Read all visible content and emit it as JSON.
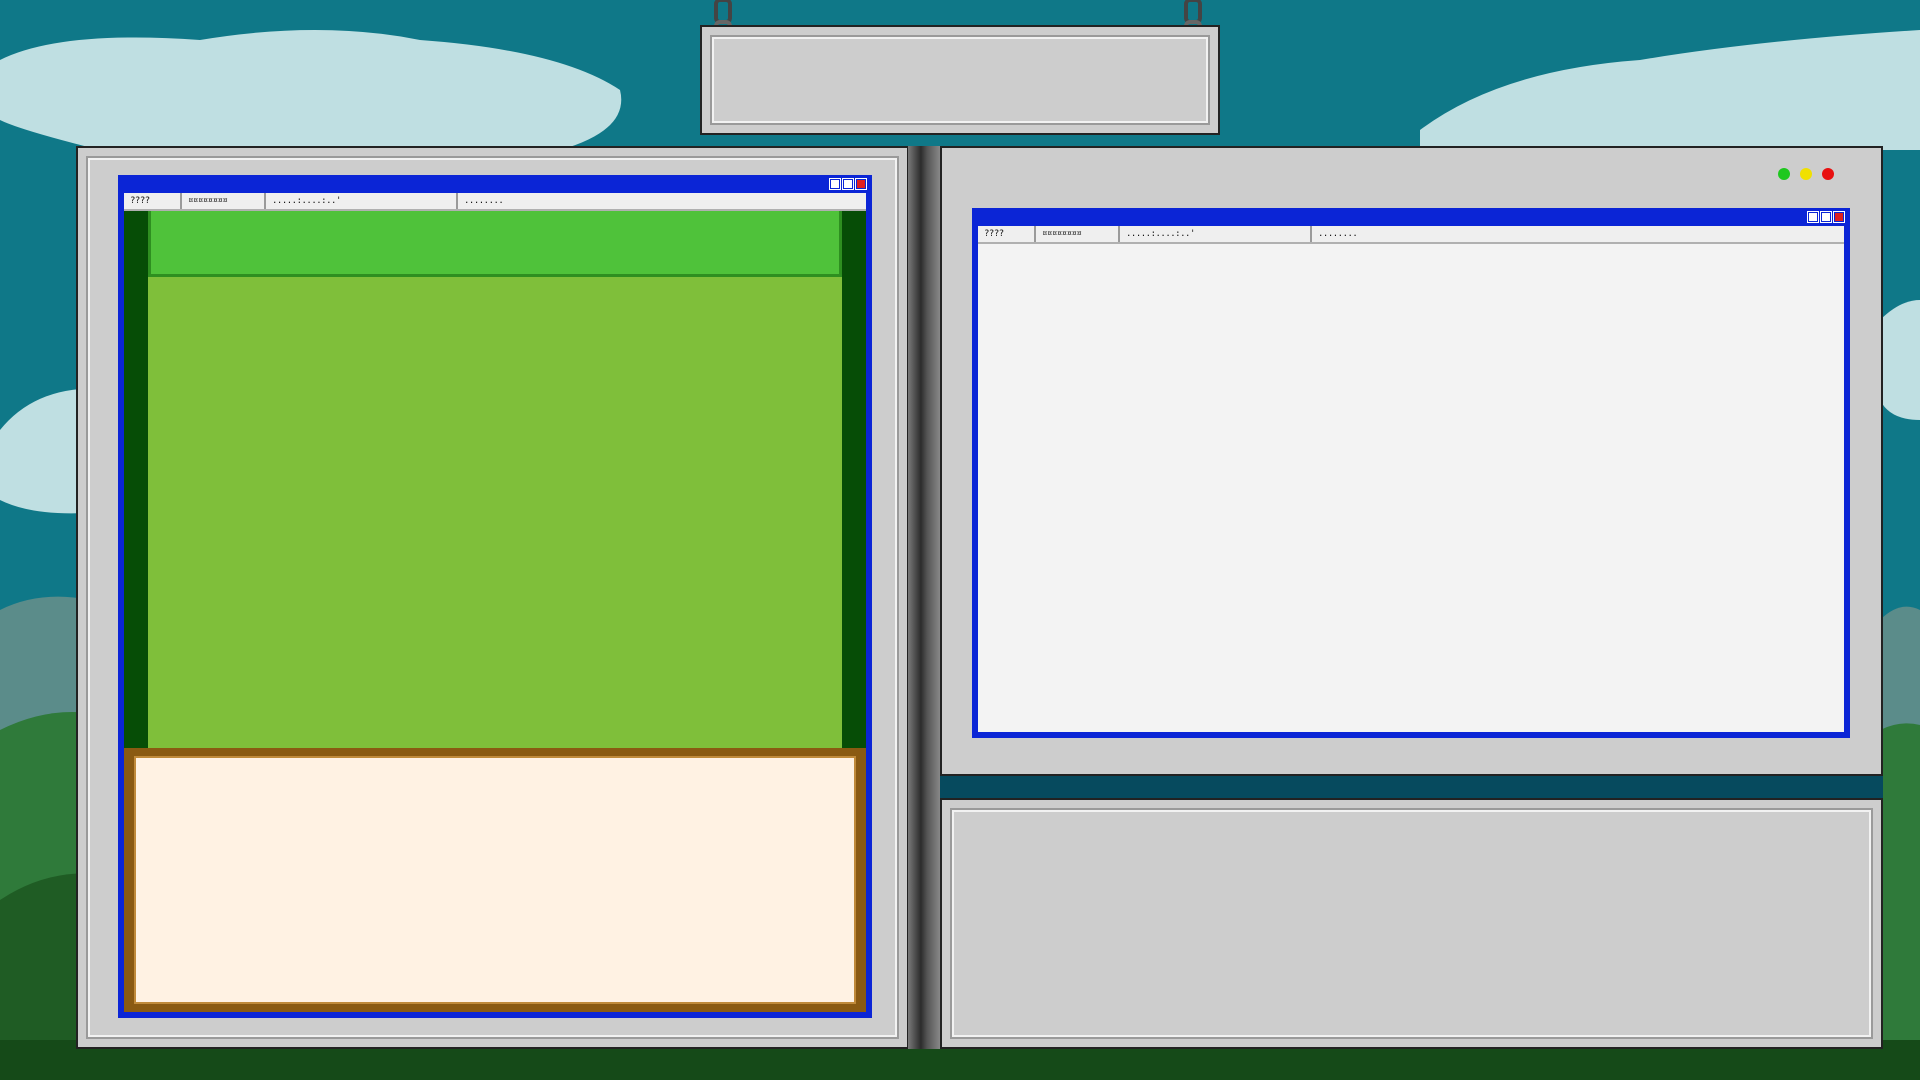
{
  "scene": {
    "sky_color": "#0f7888",
    "cloud_color": "#bfdfe2",
    "hill_colors": [
      "#5b8c8a",
      "#2f7a3a",
      "#1f5c24",
      "#154a18"
    ]
  },
  "sign_board": {
    "text": "",
    "chain_icon": "chain-icon"
  },
  "left_window": {
    "tabs": [
      "????",
      "¤¤¤¤¤¤¤¤",
      ".....:....:..'",
      "........"
    ],
    "title_buttons": [
      "minimize-icon",
      "maximize-icon",
      "close-icon"
    ],
    "header_color": "#4fc23a",
    "content_color": "#7fbf3a",
    "side_color": "#064d06",
    "dialog_box": {
      "text": "",
      "fill": "#fff2e3",
      "border": "#8a5a12"
    }
  },
  "right_window": {
    "tabs": [
      "????",
      "¤¤¤¤¤¤¤¤",
      ".....:....:..'",
      "........"
    ],
    "title_buttons": [
      "minimize-icon",
      "maximize-icon",
      "close-icon"
    ],
    "content_color": "#f3f3f3"
  },
  "status_lights": [
    "#1ec81e",
    "#f0e000",
    "#e81010"
  ],
  "bottom_panel": {
    "text": ""
  }
}
